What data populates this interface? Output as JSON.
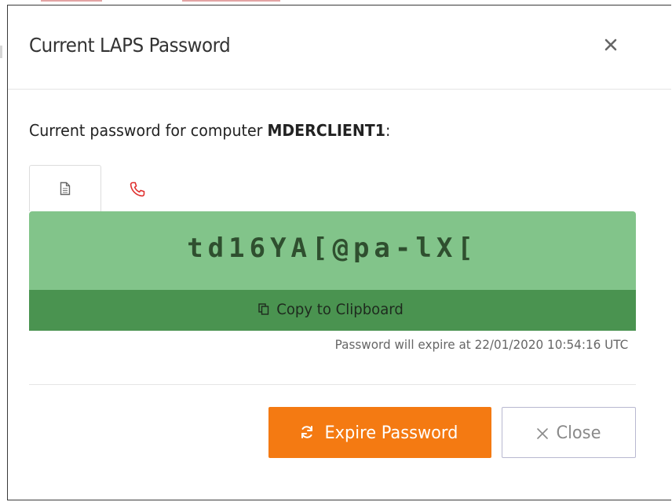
{
  "dialog": {
    "title": "Current LAPS Password",
    "close_icon": "close-icon",
    "lead_prefix": "Current password for computer ",
    "computer_name": "MDERCLIENT1",
    "lead_suffix": ":"
  },
  "tabs": [
    {
      "name": "text",
      "icon": "document-icon",
      "active": true
    },
    {
      "name": "phonetic",
      "icon": "phone-icon",
      "active": false
    }
  ],
  "password": {
    "value": "td16YA[@pa-lX[",
    "copy_label": "Copy to Clipboard",
    "copy_icon": "copy-icon",
    "expiry_text": "Password will expire at 22/01/2020 10:54:16 UTC"
  },
  "actions": {
    "expire_label": "Expire Password",
    "expire_icon": "refresh-icon",
    "close_label": "Close",
    "close_icon": "times-icon"
  },
  "colors": {
    "password_bg": "#82c48a",
    "copy_bar_bg": "#4a9350",
    "expire_button": "#f47a12",
    "phone_icon": "#e0312f"
  }
}
